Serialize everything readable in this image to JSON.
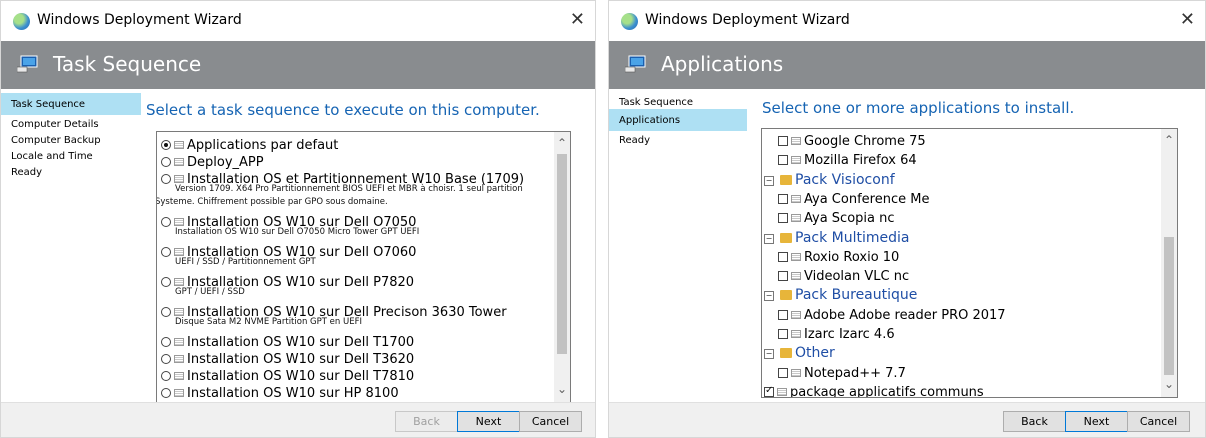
{
  "window1": {
    "title": "Windows Deployment Wizard",
    "header": "Task Sequence",
    "nav": [
      "Task Sequence",
      "Computer Details",
      "Computer Backup",
      "Locale and Time",
      "Ready"
    ],
    "prompt": "Select a task sequence to execute on this computer.",
    "items": [
      {
        "label": "Applications par defaut",
        "selected": true,
        "desc": []
      },
      {
        "label": "Deploy_APP",
        "selected": false,
        "desc": []
      },
      {
        "label": "Installation OS et Partitionnement W10 Base (1709)",
        "selected": false,
        "desc": [
          "Version 1709. X64 Pro Partitionnement BIOS UEFI et MBR à choisr. 1 seul partition",
          "Systeme. Chiffrement possible par GPO sous domaine."
        ]
      },
      {
        "label": "Installation OS W10 sur Dell O7050",
        "selected": false,
        "desc": [
          "Installation OS W10 sur Dell O7050 Micro Tower GPT UEFI"
        ]
      },
      {
        "label": "Installation OS W10 sur Dell O7060",
        "selected": false,
        "desc": [
          "UEFI / SSD / Partitionnement GPT"
        ]
      },
      {
        "label": "Installation OS W10 sur Dell P7820",
        "selected": false,
        "desc": [
          "GPT / UEFI / SSD"
        ]
      },
      {
        "label": "Installation OS W10 sur Dell Precison 3630 Tower",
        "selected": false,
        "desc": [
          "Disque Sata M2 NVME Partition GPT en UEFI"
        ]
      },
      {
        "label": "Installation OS W10 sur Dell T1700",
        "selected": false,
        "desc": []
      },
      {
        "label": "Installation OS W10 sur Dell T3620",
        "selected": false,
        "desc": []
      },
      {
        "label": "Installation OS W10 sur Dell T7810",
        "selected": false,
        "desc": []
      },
      {
        "label": "Installation OS W10 sur HP 8100",
        "selected": false,
        "desc": []
      }
    ],
    "buttons": {
      "back": "Back",
      "next": "Next",
      "cancel": "Cancel"
    }
  },
  "window2": {
    "title": "Windows Deployment Wizard",
    "header": "Applications",
    "nav": [
      "Task Sequence",
      "Applications",
      "Ready"
    ],
    "prompt": "Select one or more applications to install.",
    "items": [
      {
        "kind": "app",
        "label": "Google Chrome 75",
        "checked": false
      },
      {
        "kind": "app",
        "label": "Mozilla Firefox 64",
        "checked": false
      },
      {
        "kind": "group",
        "label": "Pack Visioconf"
      },
      {
        "kind": "app",
        "label": "Aya Conference Me",
        "checked": false
      },
      {
        "kind": "app",
        "label": "Aya Scopia nc",
        "checked": false
      },
      {
        "kind": "group",
        "label": "Pack Multimedia"
      },
      {
        "kind": "app",
        "label": "Roxio Roxio 10",
        "checked": false
      },
      {
        "kind": "app",
        "label": "Videolan VLC nc",
        "checked": false
      },
      {
        "kind": "group",
        "label": "Pack Bureautique"
      },
      {
        "kind": "app",
        "label": "Adobe Adobe reader PRO 2017",
        "checked": false
      },
      {
        "kind": "app",
        "label": "Izarc Izarc 4.6",
        "checked": false
      },
      {
        "kind": "group",
        "label": "Other"
      },
      {
        "kind": "app",
        "label": "Notepad++ 7.7",
        "checked": false
      },
      {
        "kind": "top",
        "label": "package applicatifs communs",
        "checked": true
      }
    ],
    "buttons": {
      "back": "Back",
      "next": "Next",
      "cancel": "Cancel"
    }
  }
}
